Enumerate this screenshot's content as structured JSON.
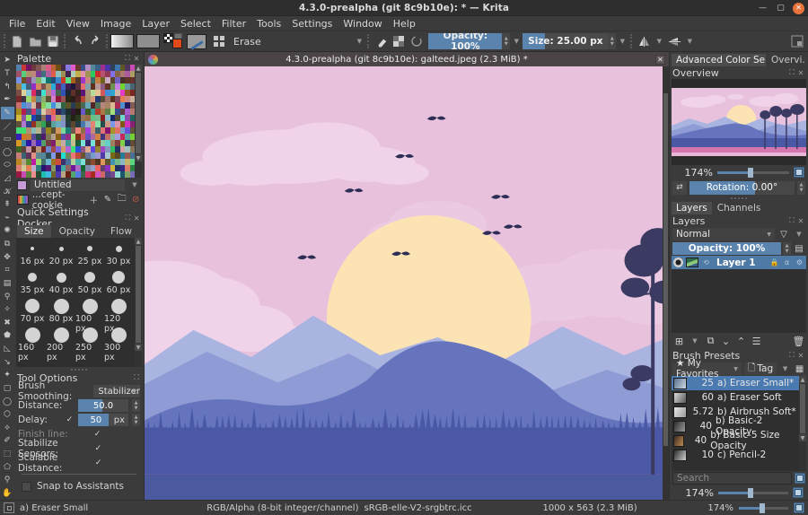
{
  "window": {
    "title": "4.3.0-prealpha (git 8c9b10e): * — Krita",
    "minimize": "—",
    "maximize": "▢",
    "close": "✕"
  },
  "menubar": {
    "items": [
      "File",
      "Edit",
      "View",
      "Image",
      "Layer",
      "Select",
      "Filter",
      "Tools",
      "Settings",
      "Window",
      "Help"
    ]
  },
  "toolbar": {
    "new_icon": "new-document-icon",
    "open_icon": "open-folder-icon",
    "save_icon": "save-icon",
    "undo_icon": "undo-icon",
    "redo_icon": "redo-icon",
    "gradient_icon": "gradient-swatch-icon",
    "pattern_icon": "pattern-swatch-icon",
    "fgbg_icon": "foreground-background-color-icon",
    "brushtip_icon": "brush-tip-icon",
    "presetchooser_icon": "preset-chooser-icon",
    "preset_name": "Erase",
    "eraser_icon": "eraser-toggle-icon",
    "alpha_icon": "preserve-alpha-icon",
    "reload_icon": "reload-preset-icon",
    "opacity_label": "Opacity: 100%",
    "size_label": "Size: 25.00 px",
    "mirror_h_icon": "mirror-horizontal-icon",
    "mirror_v_icon": "mirror-vertical-icon",
    "workspace_icon": "workspace-chooser-icon"
  },
  "tools": {
    "items": [
      {
        "name": "select-shapes-tool",
        "glyph": "➤",
        "active": false
      },
      {
        "name": "text-tool",
        "glyph": "T",
        "active": false
      },
      {
        "name": "edit-shapes-tool",
        "glyph": "↰",
        "active": false
      },
      {
        "name": "calligraphy-tool",
        "glyph": "✒",
        "active": false
      },
      {
        "name": "freehand-brush-tool",
        "glyph": "✎",
        "active": true
      },
      {
        "name": "line-tool",
        "glyph": "／",
        "active": false
      },
      {
        "name": "rectangle-tool",
        "glyph": "▭",
        "active": false
      },
      {
        "name": "ellipse-tool",
        "glyph": "◯",
        "active": false
      },
      {
        "name": "polygon-tool",
        "glyph": "⬭",
        "active": false
      },
      {
        "name": "polyline-tool",
        "glyph": "◿",
        "active": false
      },
      {
        "name": "bezier-curve-tool",
        "glyph": "𝒦",
        "active": false
      },
      {
        "name": "freehand-path-tool",
        "glyph": "⇞",
        "active": false
      },
      {
        "name": "dynamic-brush-tool",
        "glyph": "⌁",
        "active": false
      },
      {
        "name": "multibrush-tool",
        "glyph": "✺",
        "active": false
      },
      {
        "name": "transform-tool",
        "glyph": "⧉",
        "active": false
      },
      {
        "name": "move-tool",
        "glyph": "✥",
        "active": false
      },
      {
        "name": "crop-tool",
        "glyph": "⌗",
        "active": false
      },
      {
        "name": "gradient-tool",
        "glyph": "▤",
        "active": false
      },
      {
        "name": "color-sampler-tool",
        "glyph": "⚲",
        "active": false
      },
      {
        "name": "colorize-mask-tool",
        "glyph": "✧",
        "active": false
      },
      {
        "name": "smart-patch-tool",
        "glyph": "✖",
        "active": false
      },
      {
        "name": "fill-tool",
        "glyph": "⬟",
        "active": false
      },
      {
        "name": "enclose-fill-tool",
        "glyph": "◺",
        "active": false
      },
      {
        "name": "measure-tool",
        "glyph": "↘",
        "active": false
      },
      {
        "name": "assistant-tool",
        "glyph": "✦",
        "active": false
      },
      {
        "name": "rectangular-selection-tool",
        "glyph": "▢",
        "active": false
      },
      {
        "name": "elliptical-selection-tool",
        "glyph": "◯",
        "active": false
      },
      {
        "name": "polygonal-selection-tool",
        "glyph": "⬡",
        "active": false
      },
      {
        "name": "freehand-selection-tool",
        "glyph": "⟡",
        "active": false
      },
      {
        "name": "contiguous-selection-tool",
        "glyph": "✐",
        "active": false
      },
      {
        "name": "similar-color-selection-tool",
        "glyph": "⬚",
        "active": false
      },
      {
        "name": "bezier-selection-tool",
        "glyph": "⬠",
        "active": false
      },
      {
        "name": "magnetic-selection-tool",
        "glyph": "⚲",
        "active": false
      },
      {
        "name": "pan-tool",
        "glyph": "✋",
        "active": false
      }
    ]
  },
  "palette_docker": {
    "title": "Palette",
    "float_icon": "float-docker-icon",
    "close_icon": "close-docker-icon",
    "selected_palette": "Untitled",
    "palette_file": "...cept-cookie",
    "add_icon": "add-swatch-icon",
    "edit_icon": "edit-swatch-icon",
    "folder_icon": "open-palette-icon",
    "remove_icon": "remove-swatch-icon"
  },
  "quick_settings": {
    "title": "Quick Settings Docker",
    "tabs": [
      {
        "label": "Size",
        "active": true
      },
      {
        "label": "Opacity",
        "active": false
      },
      {
        "label": "Flow",
        "active": false
      }
    ],
    "sizes": [
      {
        "label": "16 px",
        "dot": 4
      },
      {
        "label": "20 px",
        "dot": 5
      },
      {
        "label": "25 px",
        "dot": 6
      },
      {
        "label": "30 px",
        "dot": 7
      },
      {
        "label": "35 px",
        "dot": 10
      },
      {
        "label": "40 px",
        "dot": 11
      },
      {
        "label": "50 px",
        "dot": 12
      },
      {
        "label": "60 px",
        "dot": 14
      },
      {
        "label": "70 px",
        "dot": 16
      },
      {
        "label": "80 px",
        "dot": 17
      },
      {
        "label": "100 px",
        "dot": 17
      },
      {
        "label": "120 px",
        "dot": 17
      },
      {
        "label": "160 px",
        "dot": 17
      },
      {
        "label": "200 px",
        "dot": 17
      },
      {
        "label": "250 px",
        "dot": 17
      },
      {
        "label": "300 px",
        "dot": 17
      }
    ]
  },
  "tool_options": {
    "title": "Tool Options",
    "brush_smoothing_label": "Brush Smoothing:",
    "brush_smoothing_value": "Stabilizer",
    "distance_label": "Distance:",
    "distance_value": "50.0",
    "delay_label": "Delay:",
    "delay_value": "50",
    "delay_unit": "px",
    "delay_checked": "✓",
    "finish_line_label": "Finish line:",
    "finish_line_checked": "✓",
    "stabilize_sensors_label": "Stabilize Sensors:",
    "stabilize_sensors_checked": "✓",
    "scalable_distance_label": "Scalable Distance:",
    "scalable_distance_checked": "✓",
    "snap_to_assistants_label": "Snap to Assistants"
  },
  "canvas": {
    "subwindow_title": "4.3.0-prealpha (git 8c9b10e): galteed.jpeg (2.3 MiB) *",
    "app_icon": "krita-icon",
    "close_icon": "close-subwindow-icon"
  },
  "right_dock": {
    "tabs": [
      {
        "label": "Advanced Color Selec...",
        "active": true
      },
      {
        "label": "Overvi...",
        "active": false
      }
    ],
    "overview": {
      "title": "Overview",
      "zoom": "174%",
      "zoom_fit_icon": "fit-page-icon",
      "rotation_label": "Rotation: 0.00°",
      "reset_rotation_icon": "reset-rotation-icon"
    },
    "layers": {
      "tabs": [
        {
          "label": "Layers",
          "active": true
        },
        {
          "label": "Channels",
          "active": false
        }
      ],
      "title": "Layers",
      "blend_mode": "Normal",
      "filter_icon": "filter-layers-icon",
      "opacity_label": "Opacity:  100%",
      "properties_icon": "layer-properties-icon",
      "rows": [
        {
          "name": "Layer 1",
          "visible_icon": "eye-icon",
          "filter_mask_icon": "filter-mask-icon",
          "lock_icon": "lock-icon",
          "alpha_icon": "alpha-lock-icon",
          "style_icon": "layer-style-icon"
        }
      ],
      "tools": [
        {
          "name": "add-layer-button",
          "glyph": "⊞"
        },
        {
          "name": "duplicate-layer-button",
          "glyph": "⧉"
        },
        {
          "name": "move-layer-down-button",
          "glyph": "⌄"
        },
        {
          "name": "move-layer-up-button",
          "glyph": "⌃"
        },
        {
          "name": "layer-properties-button",
          "glyph": "☰"
        },
        {
          "name": "delete-layer-button",
          "glyph": "🗑"
        }
      ]
    },
    "brush_presets": {
      "title": "Brush Presets",
      "tag_selected": "★ My Favorites",
      "tag_button": "Tag",
      "settings_icon": "brush-presets-settings-icon",
      "items": [
        {
          "size": "25",
          "name": "a) Eraser Small*",
          "selected": true
        },
        {
          "size": "60",
          "name": "a) Eraser Soft",
          "selected": false
        },
        {
          "size": "5.72",
          "name": "b) Airbrush Soft*",
          "selected": false
        },
        {
          "size": "40",
          "name": "b) Basic-2 Opacity",
          "selected": false
        },
        {
          "size": "40",
          "name": "b) Basic-5 Size Opacity",
          "selected": false
        },
        {
          "size": "10",
          "name": "c) Pencil-2",
          "selected": false
        }
      ],
      "search_placeholder": "Search",
      "save_icon": "save-preset-icon"
    },
    "bottom_zoom": "174%"
  },
  "statusbar": {
    "selection_icon": "selection-mask-icon",
    "brush_preset": "a) Eraser Small",
    "color_model": "RGB/Alpha (8-bit integer/channel)",
    "color_profile": "sRGB-elle-V2-srgbtrc.icc",
    "dimensions": "1000 x 563 (2.3 MiB)",
    "zoom": "174%",
    "fit_icon": "fit-canvas-icon"
  },
  "artwork": {
    "colors": {
      "sky": "#e8c2dc",
      "cloud": "#f0d3e8",
      "cloud_dark": "#e3bcd9",
      "sun": "#fbe3b4",
      "mountain_far": "#a9b4e0",
      "mountain_mid": "#8e9bd4",
      "mountain_near": "#6574bd",
      "forest": "#4a58a6",
      "water_top": "#4b5a9e",
      "water_pink": "#d577ae",
      "water_light": "#e7b6d9",
      "rock": "#3b3a63",
      "tree_dark": "#3b3a63",
      "bird": "#2e2d55"
    }
  }
}
